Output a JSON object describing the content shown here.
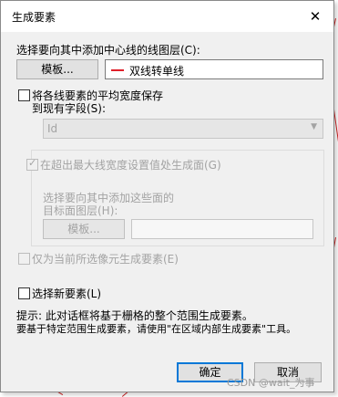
{
  "dialog": {
    "title": "生成要素",
    "close_glyph": "✕"
  },
  "layer_section": {
    "label": "选择要向其中添加中心线的线图层(C):",
    "template_button": "模板...",
    "layer_value": "双线转单线"
  },
  "save_width": {
    "checkbox_label": "将各线要素的平均宽度保存",
    "field_label": "到现有字段(S):",
    "field_value": "Id",
    "checked": false
  },
  "generate_polygons": {
    "checkbox_label": "在超出最大线宽度设置值处生成面(G)",
    "checked": true,
    "target_label_line1": "选择要向其中添加这些面的",
    "target_label_line2": "目标面图层(H):",
    "template_button": "模板...",
    "layer_value": ""
  },
  "selected_cells_only": {
    "label": "仅为当前所选像元生成要素(E)",
    "checked": false
  },
  "select_new": {
    "label": "选择新要素(L)",
    "checked": false
  },
  "hint": {
    "line1": "提示: 此对话框将基于栅格的整个范围生成要素。",
    "line2": "要基于特定范围生成要素，请使用\"在区域内部生成要素\"工具。"
  },
  "buttons": {
    "ok": "确定",
    "cancel": "取消"
  },
  "watermark": "CSDN @wait_为事",
  "colors": {
    "layer_swatch": "#e0202a",
    "default_button_border": "#0078d7"
  }
}
